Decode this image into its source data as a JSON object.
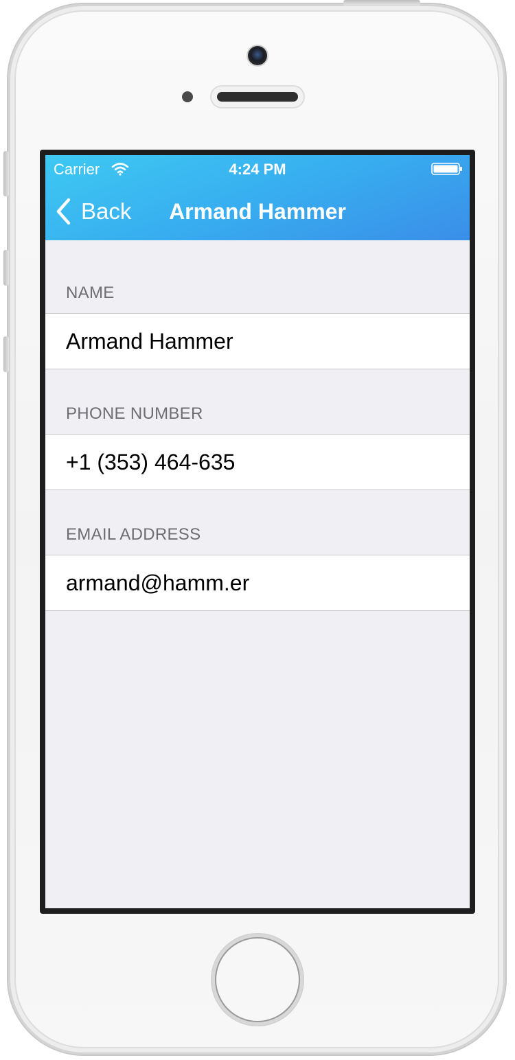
{
  "status_bar": {
    "carrier": "Carrier",
    "time": "4:24 PM"
  },
  "nav_bar": {
    "back_label": "Back",
    "title": "Armand Hammer",
    "gradient_start": "#3ec9f2",
    "gradient_end": "#3a8ee8"
  },
  "sections": {
    "name": {
      "header": "NAME",
      "value": "Armand Hammer"
    },
    "phone": {
      "header": "PHONE NUMBER",
      "value": "+1 (353) 464-635"
    },
    "email": {
      "header": "EMAIL ADDRESS",
      "value": "armand@hamm.er"
    }
  },
  "colors": {
    "background": "#efeff4",
    "section_header": "#6d6d72",
    "cell_background": "#ffffff"
  },
  "icons": [
    "wifi-icon",
    "battery-icon",
    "chevron-left-icon",
    "camera-icon",
    "home-button"
  ]
}
